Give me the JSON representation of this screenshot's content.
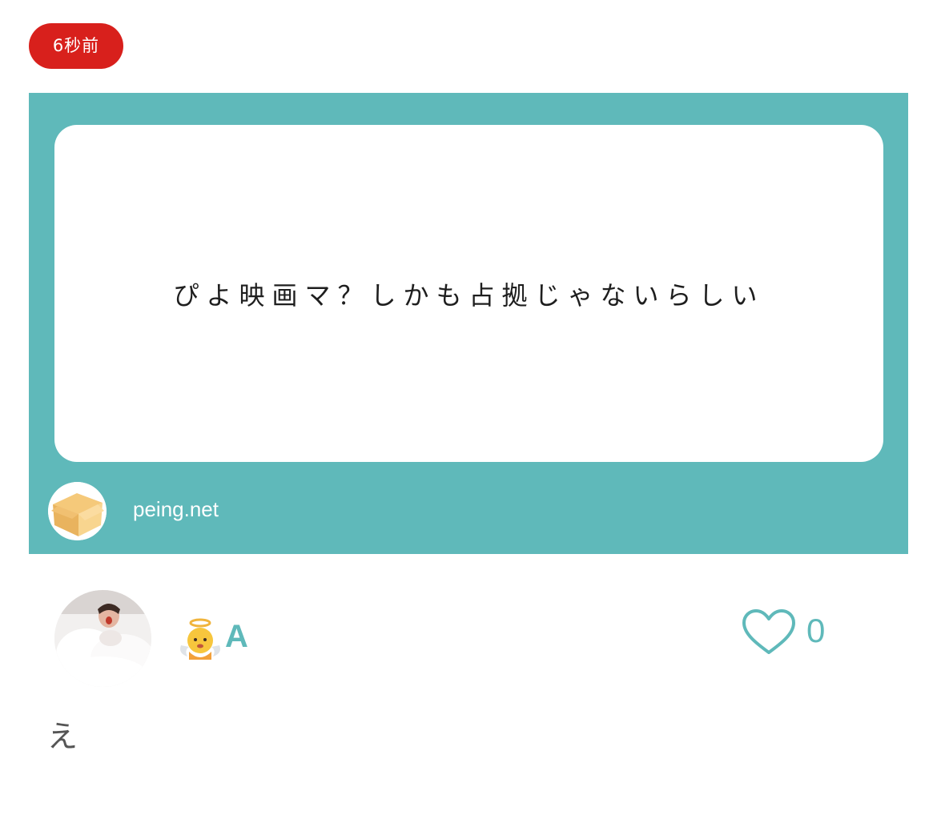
{
  "timestamp_badge": "6秒前",
  "question": {
    "text": "ぴよ映画マ？しかも占拠じゃないらしい",
    "source": "peing.net"
  },
  "answerer": {
    "name": "A",
    "emoji_icon": "baby-angel-icon"
  },
  "like": {
    "icon": "heart-outline-icon",
    "count": "0"
  },
  "answer": {
    "text": "え"
  },
  "colors": {
    "badge": "#d8201c",
    "accent": "#5fb9ba",
    "answer_text": "#555555"
  }
}
